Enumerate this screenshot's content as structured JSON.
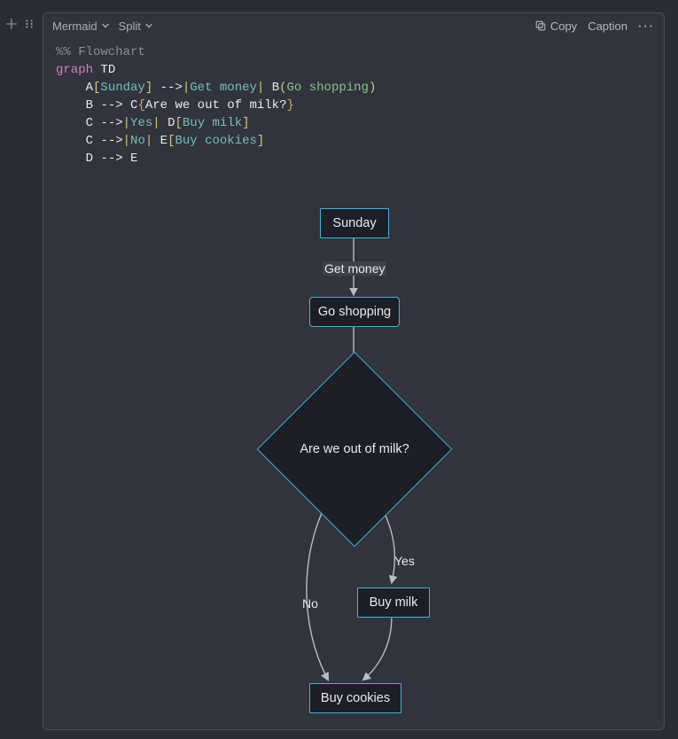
{
  "toolbar": {
    "mode_label": "Mermaid",
    "layout_label": "Split",
    "copy_label": "Copy",
    "caption_label": "Caption"
  },
  "code": {
    "l1_comment": "%% Flowchart",
    "l2_graph": "graph",
    "l2_dir": "TD",
    "l3_pre": "A",
    "l3_bracket_open": "[",
    "l3_sunday": "Sunday",
    "l3_bracket_close": "]",
    "l3_arrow": "-->",
    "l3_pipe1": "|",
    "l3_getmoney": "Get money",
    "l3_pipe2": "|",
    "l3_b": "B",
    "l3_paren_open": "(",
    "l3_goshop": "Go shopping",
    "l3_paren_close": ")",
    "l4_b": "B",
    "l4_arrow": "-->",
    "l4_c": "C",
    "l4_brace_open": "{",
    "l4_q": "Are we out of milk?",
    "l4_brace_close": "}",
    "l5_c": "C",
    "l5_arrow": "-->",
    "l5_pipe1": "|",
    "l5_yes": "Yes",
    "l5_pipe2": "|",
    "l5_d": "D",
    "l5_bopen": "[",
    "l5_buymilk": "Buy milk",
    "l5_bclose": "]",
    "l6_c": "C",
    "l6_arrow": "-->",
    "l6_pipe1": "|",
    "l6_no": "No",
    "l6_pipe2": "|",
    "l6_e": "E",
    "l6_bopen": "[",
    "l6_cookies": "Buy cookies",
    "l6_bclose": "]",
    "l7_d": "D",
    "l7_arrow": "-->",
    "l7_e": "E"
  },
  "diagram": {
    "nodes": {
      "A": "Sunday",
      "B": "Go shopping",
      "C": "Are we out of milk?",
      "D": "Buy milk",
      "E": "Buy cookies"
    },
    "edge_labels": {
      "AB": "Get money",
      "CD": "Yes",
      "CE": "No"
    }
  },
  "colors": {
    "node_border": "#45b2d9",
    "node_fill": "#1c1f26",
    "arrow": "#b8bdc5"
  }
}
